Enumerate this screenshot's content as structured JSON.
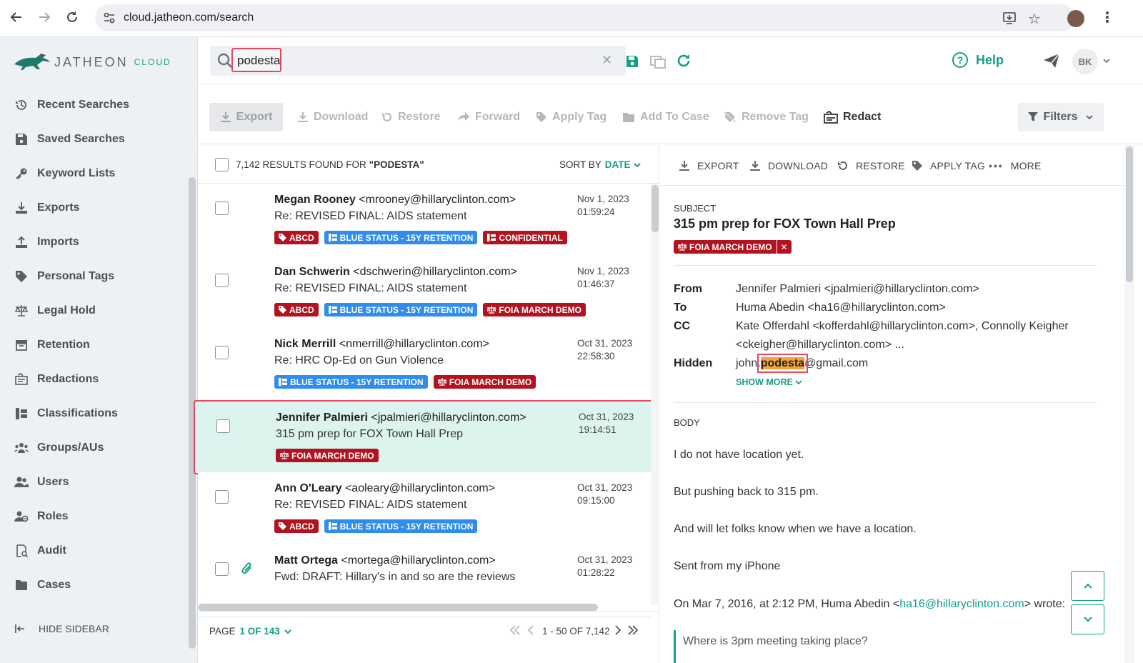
{
  "browser": {
    "url": "cloud.jatheon.com/search"
  },
  "brand": {
    "name": "JATHEON",
    "sub": "CLOUD",
    "accent": "#14a085",
    "red": "#b3121f",
    "blue": "#2f8df0"
  },
  "sidebar": {
    "items": [
      {
        "label": "Recent Searches",
        "icon": "history-icon"
      },
      {
        "label": "Saved Searches",
        "icon": "save-icon"
      },
      {
        "label": "Keyword Lists",
        "icon": "key-icon"
      },
      {
        "label": "Exports",
        "icon": "download-icon"
      },
      {
        "label": "Imports",
        "icon": "upload-icon"
      },
      {
        "label": "Personal Tags",
        "icon": "tag-icon"
      },
      {
        "label": "Legal Hold",
        "icon": "scale-icon"
      },
      {
        "label": "Retention",
        "icon": "archive-icon"
      },
      {
        "label": "Redactions",
        "icon": "redact-icon"
      },
      {
        "label": "Classifications",
        "icon": "classification-icon"
      },
      {
        "label": "Groups/AUs",
        "icon": "groups-icon"
      },
      {
        "label": "Users",
        "icon": "users-icon"
      },
      {
        "label": "Roles",
        "icon": "roles-icon"
      },
      {
        "label": "Audit",
        "icon": "audit-icon"
      },
      {
        "label": "Cases",
        "icon": "folder-icon"
      }
    ],
    "hide_label": "HIDE SIDEBAR"
  },
  "search": {
    "query": "podesta"
  },
  "header": {
    "help_label": "Help",
    "avatar_initials": "BK"
  },
  "toolbar": {
    "export": "Export",
    "download": "Download",
    "restore": "Restore",
    "forward": "Forward",
    "apply_tag": "Apply Tag",
    "add_to_case": "Add To Case",
    "remove_tag": "Remove Tag",
    "redact": "Redact",
    "filters": "Filters"
  },
  "list": {
    "results_prefix": "7,142 RESULTS FOUND FOR",
    "results_query": "\"PODESTA\"",
    "sort_label": "SORT BY",
    "sort_value": "DATE",
    "rows": [
      {
        "name": "Megan Rooney",
        "email": "<mrooney@hillaryclinton.com>",
        "subject": "Re: REVISED FINAL: AIDS statement",
        "date": "Nov 1, 2023",
        "time": "01:59:24",
        "tags": [
          {
            "label": "ABCD",
            "color": "red",
            "icon": "tag-icon"
          },
          {
            "label": "BLUE STATUS - 15Y RETENTION",
            "color": "blue",
            "icon": "retention-icon"
          },
          {
            "label": "CONFIDENTIAL",
            "color": "red",
            "icon": "retention-icon"
          }
        ]
      },
      {
        "name": "Dan Schwerin",
        "email": "<dschwerin@hillaryclinton.com>",
        "subject": "Re: REVISED FINAL: AIDS statement",
        "date": "Nov 1, 2023",
        "time": "01:46:37",
        "tags": [
          {
            "label": "ABCD",
            "color": "red",
            "icon": "tag-icon"
          },
          {
            "label": "BLUE STATUS - 15Y RETENTION",
            "color": "blue",
            "icon": "retention-icon"
          },
          {
            "label": "FOIA MARCH DEMO",
            "color": "red",
            "icon": "scale-icon"
          }
        ]
      },
      {
        "name": "Nick Merrill",
        "email": "<nmerrill@hillaryclinton.com>",
        "subject": "Re: HRC Op-Ed on Gun Violence",
        "date": "Oct 31, 2023",
        "time": "22:58:30",
        "tags": [
          {
            "label": "BLUE STATUS - 15Y RETENTION",
            "color": "blue",
            "icon": "retention-icon"
          },
          {
            "label": "FOIA MARCH DEMO",
            "color": "red",
            "icon": "scale-icon"
          }
        ]
      },
      {
        "name": "Jennifer Palmieri",
        "email": "<jpalmieri@hillaryclinton.com>",
        "subject": "315 pm prep for FOX Town Hall Prep",
        "date": "Oct 31, 2023",
        "time": "19:14:51",
        "tags": [
          {
            "label": "FOIA MARCH DEMO",
            "color": "red",
            "icon": "scale-icon"
          }
        ]
      },
      {
        "name": "Ann O'Leary",
        "email": "<aoleary@hillaryclinton.com>",
        "subject": "Re: REVISED FINAL: AIDS statement",
        "date": "Oct 31, 2023",
        "time": "09:15:00",
        "tags": [
          {
            "label": "ABCD",
            "color": "red",
            "icon": "tag-icon"
          },
          {
            "label": "BLUE STATUS - 15Y RETENTION",
            "color": "blue",
            "icon": "retention-icon"
          }
        ]
      },
      {
        "name": "Matt Ortega",
        "email": "<mortega@hillaryclinton.com>",
        "subject": "Fwd: DRAFT: Hillary's in and so are the reviews",
        "date": "Oct 31, 2023",
        "time": "01:28:22",
        "tags": []
      }
    ],
    "page_label": "PAGE",
    "page_value": "1 OF 143",
    "range": "1 - 50 OF 7,142"
  },
  "detail": {
    "actions": {
      "export": "EXPORT",
      "download": "DOWNLOAD",
      "restore": "RESTORE",
      "apply_tag": "APPLY TAG",
      "more": "MORE"
    },
    "subject_label": "SUBJECT",
    "subject": "315 pm prep for FOX Town Hall Prep",
    "tag": "FOIA MARCH DEMO",
    "from_label": "From",
    "from": "Jennifer Palmieri <jpalmieri@hillaryclinton.com>",
    "to_label": "To",
    "to": "Huma Abedin <ha16@hillaryclinton.com>",
    "cc_label": "CC",
    "cc_line1": "Kate Offerdahl <kofferdahl@hillaryclinton.com>, Connolly Keigher",
    "cc_line2": "<ckeigher@hillaryclinton.com> ...",
    "hidden_label": "Hidden",
    "hidden_pre": "john.",
    "hidden_hit": "podesta",
    "hidden_post": "@gmail.com",
    "show_more": "SHOW MORE",
    "body_label": "BODY",
    "body": [
      "I do not have location yet.",
      "But pushing back to 315 pm.",
      "And will let folks know when we have a location.",
      "Sent from my iPhone"
    ],
    "quote_intro_pre": "On Mar 7, 2016, at 2:12 PM, Huma Abedin <",
    "quote_link": "ha16@hillaryclinton.com",
    "quote_intro_post": "> wrote:",
    "quote": "Where is 3pm meeting taking place?"
  }
}
